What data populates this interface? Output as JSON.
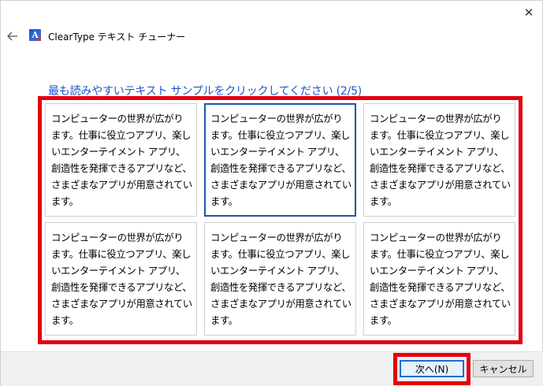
{
  "window": {
    "close_glyph": "✕",
    "title": "ClearType テキスト チューナー"
  },
  "heading": "最も読みやすいテキスト サンプルをクリックしてください (2/5)",
  "samples": [
    {
      "text": "コンピューターの世界が広がります。仕事に役立つアプリ、楽しいエンターテイメント アプリ、創造性を発揮できるアプリなど、さまざまなアプリが用意されています。",
      "selected": false
    },
    {
      "text": "コンピューターの世界が広がります。仕事に役立つアプリ、楽しいエンターテイメント アプリ、創造性を発揮できるアプリなど、さまざまなアプリが用意されています。",
      "selected": true
    },
    {
      "text": "コンピューターの世界が広がります。仕事に役立つアプリ、楽しいエンターテイメント アプリ、創造性を発揮できるアプリなど、さまざまなアプリが用意されています。",
      "selected": false
    },
    {
      "text": "コンピューターの世界が広がります。仕事に役立つアプリ、楽しいエンターテイメント アプリ、創造性を発揮できるアプリなど、さまざまなアプリが用意されています。",
      "selected": false
    },
    {
      "text": "コンピューターの世界が広がります。仕事に役立つアプリ、楽しいエンターテイメント アプリ、創造性を発揮できるアプリなど、さまざまなアプリが用意されています。",
      "selected": false
    },
    {
      "text": "コンピューターの世界が広がります。仕事に役立つアプリ、楽しいエンターテイメント アプリ、創造性を発揮できるアプリなど、さまざまなアプリが用意されています。",
      "selected": false
    }
  ],
  "buttons": {
    "next_label": "次へ(N)",
    "cancel_label": "キャンセル"
  },
  "colors": {
    "heading": "#1a56c8",
    "highlight": "#e3000f",
    "selected_border": "#1a56a8"
  },
  "icons": {
    "back": "back-arrow-icon",
    "app": "cleartype-app-icon",
    "close": "close-icon"
  }
}
